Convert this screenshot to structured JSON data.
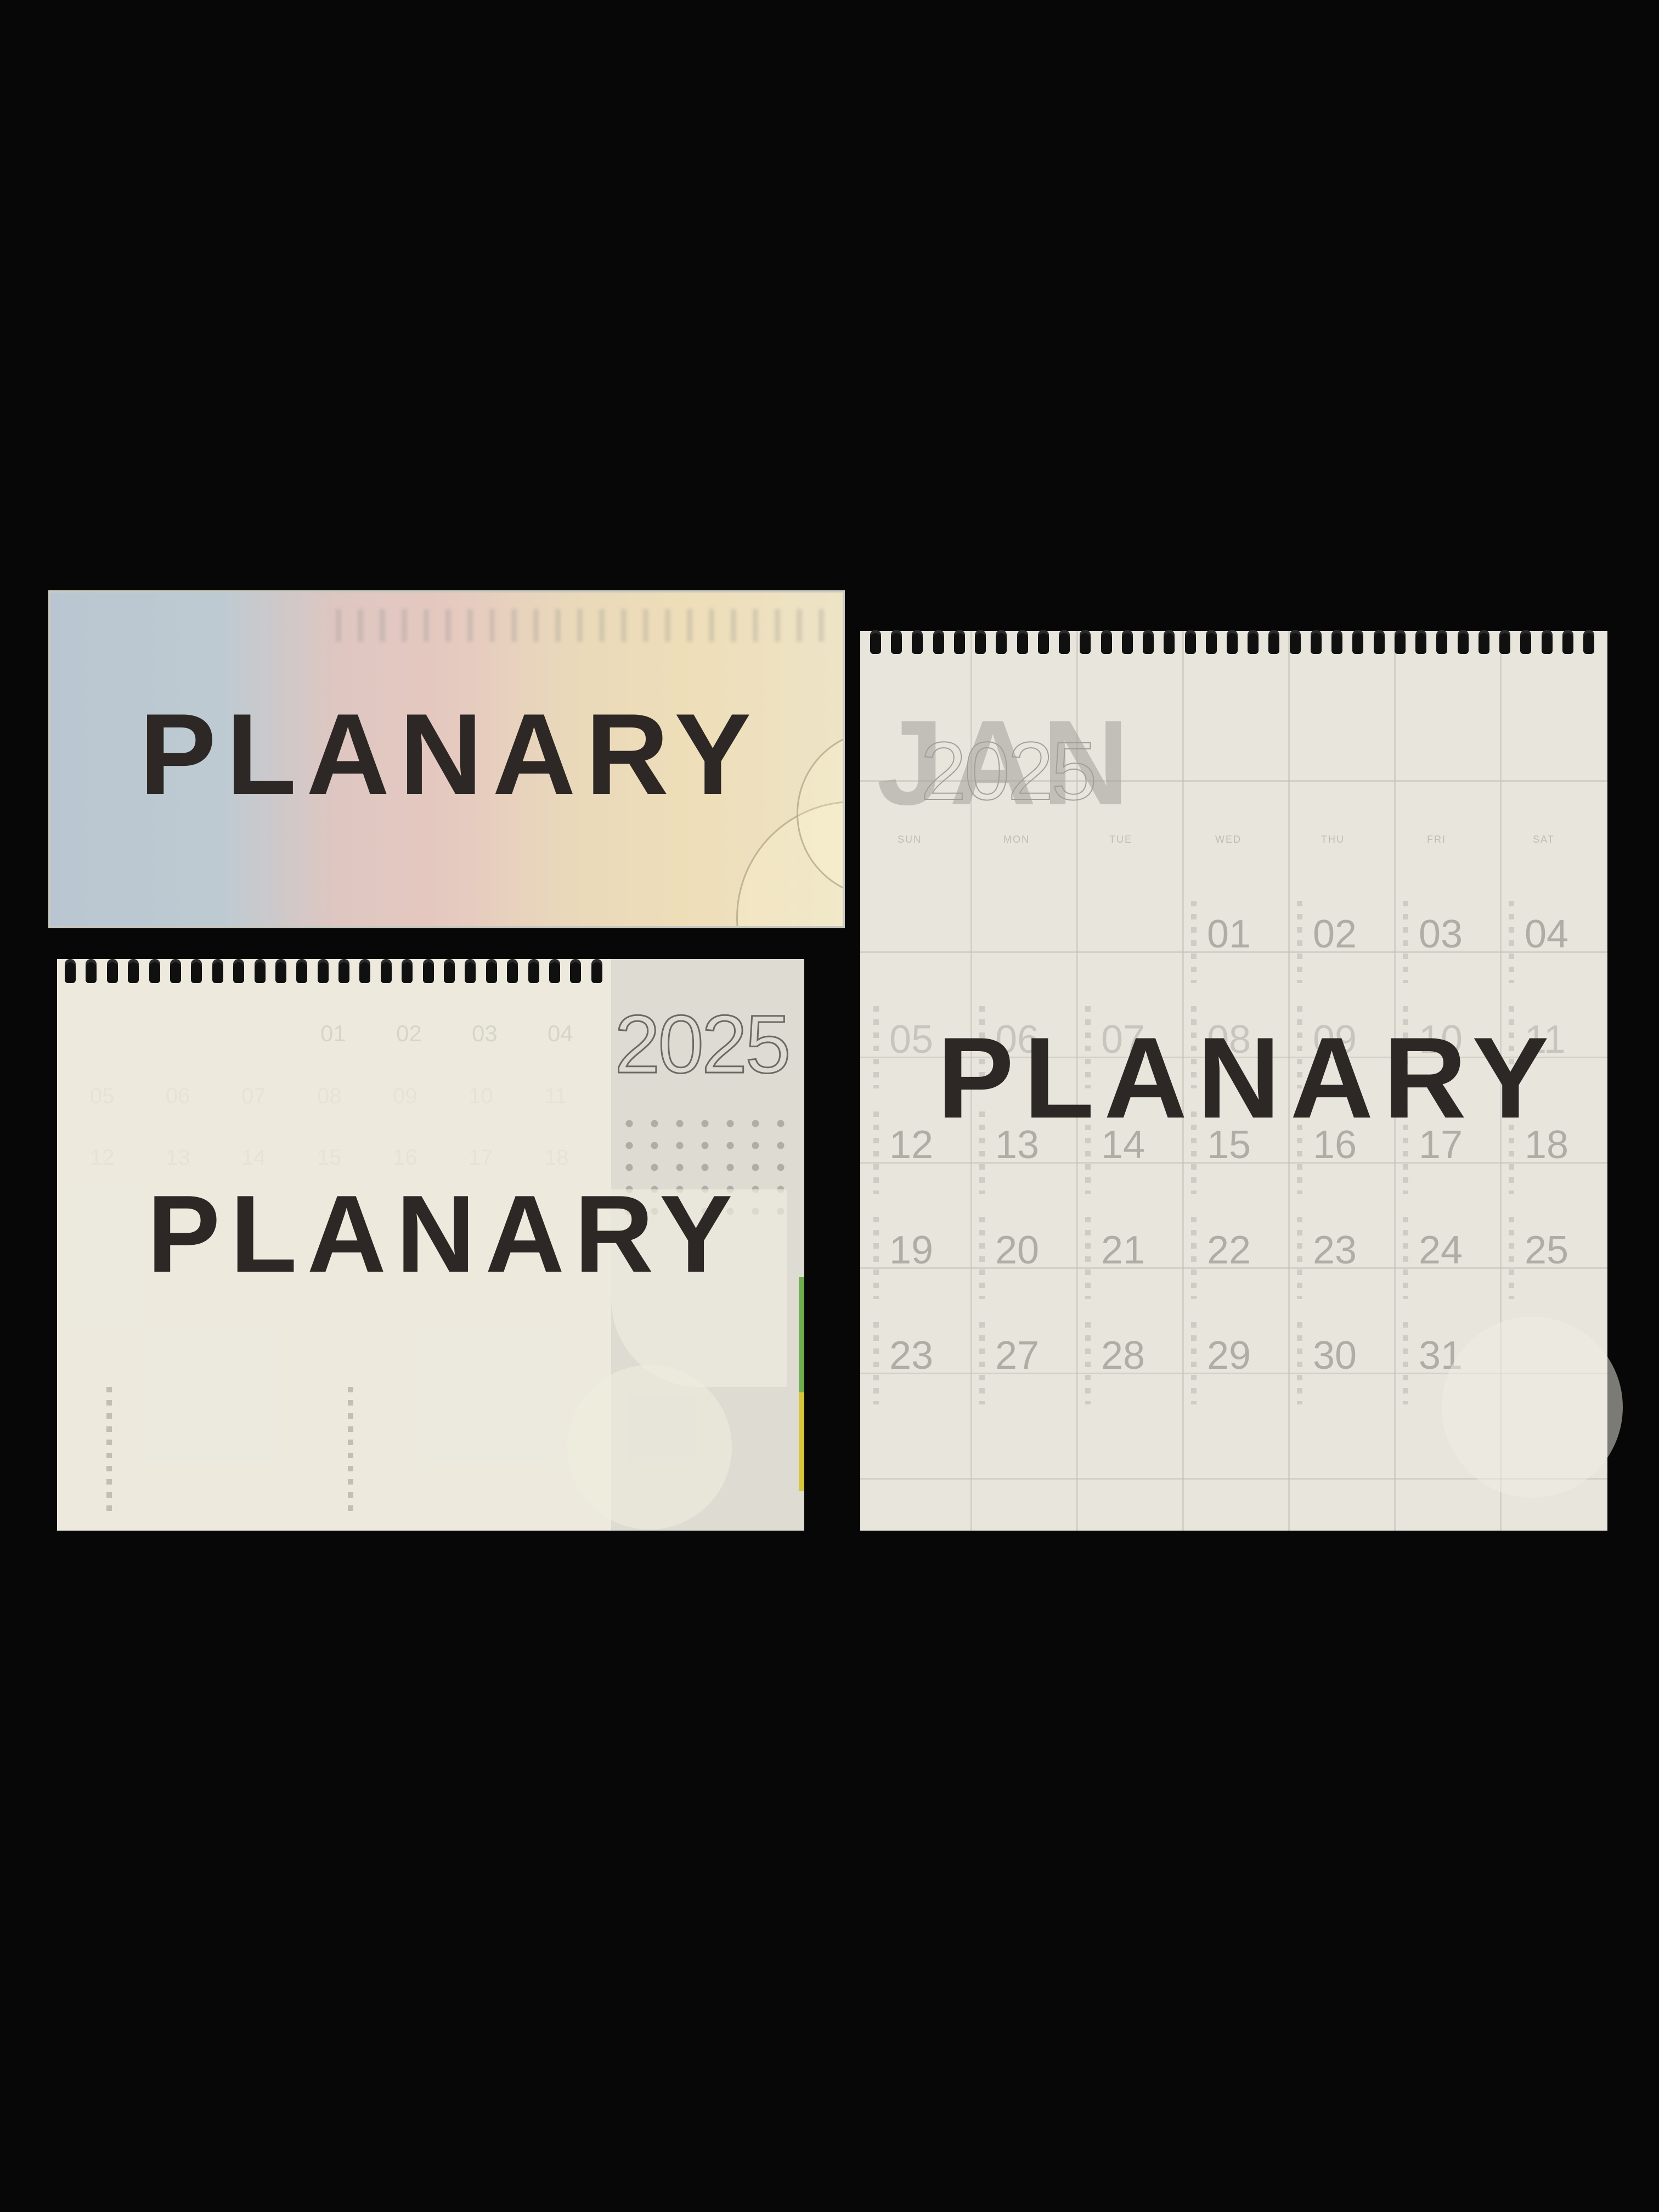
{
  "brand": "PLANARY",
  "box": {
    "brand": "PLANARY"
  },
  "small_calendar": {
    "brand": "PLANARY",
    "year": "2025",
    "top_row": [
      "01",
      "02",
      "03",
      "04"
    ],
    "faint_rows": [
      [
        "05",
        "06",
        "07",
        "08",
        "09",
        "10",
        "11"
      ],
      [
        "12",
        "13",
        "14",
        "15",
        "16",
        "17",
        "18"
      ]
    ]
  },
  "large_calendar": {
    "brand": "PLANARY",
    "month": "JAN",
    "year": "2025",
    "weekdays": [
      "SUN",
      "MON",
      "TUE",
      "WED",
      "THU",
      "FRI",
      "SAT"
    ],
    "days": [
      [
        "",
        "",
        "",
        "01",
        "02",
        "03",
        "04"
      ],
      [
        "05",
        "06",
        "07",
        "08",
        "09",
        "10",
        "11"
      ],
      [
        "12",
        "13",
        "14",
        "15",
        "16",
        "17",
        "18"
      ],
      [
        "19",
        "20",
        "21",
        "22",
        "23",
        "24",
        "25"
      ],
      [
        "23",
        "27",
        "28",
        "29",
        "30",
        "31",
        ""
      ]
    ]
  },
  "colors": {
    "background": "#070707",
    "ink": "#2d2825",
    "paper": "#e7e5dc",
    "box_blue": "#a7b9c8",
    "box_pink": "#e2b7ad",
    "box_yellow": "#f0d7a0"
  }
}
